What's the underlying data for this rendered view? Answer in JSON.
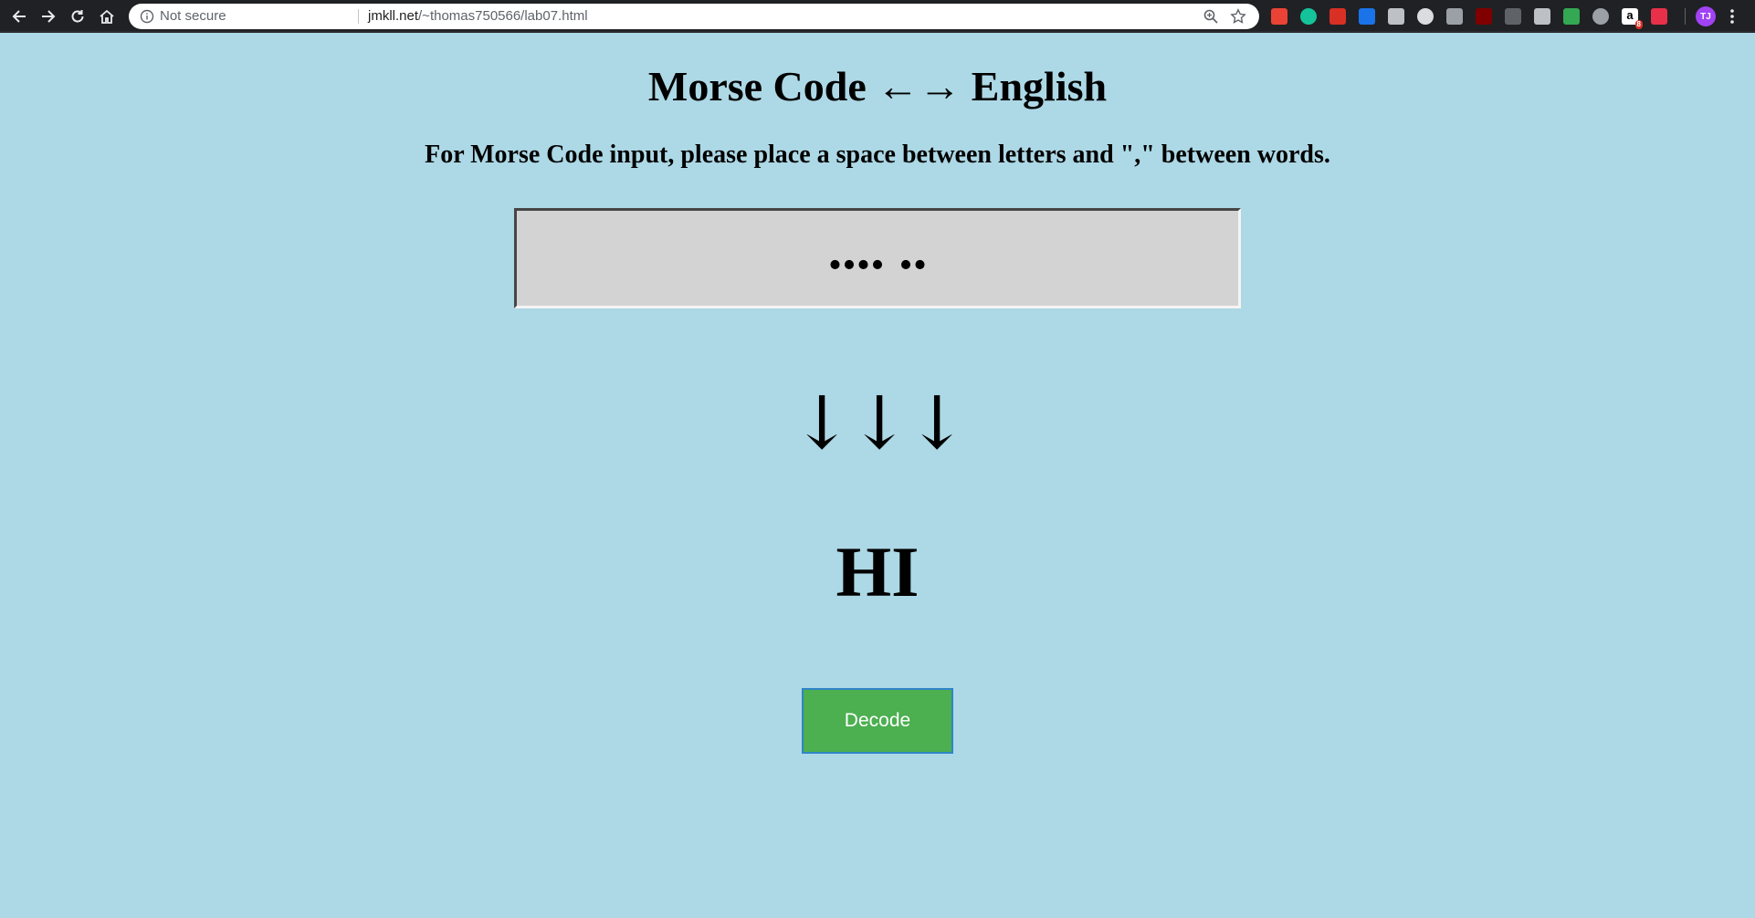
{
  "browser": {
    "security_label": "Not secure",
    "url_host": "jmkll.net",
    "url_path": "/~thomas750566/lab07.html",
    "profile_initials": "TJ",
    "extension_badge": "8",
    "extensions": [
      {
        "icon": "gmail-extension-icon",
        "color": "#ea4335"
      },
      {
        "icon": "grammarly-extension-icon",
        "color": "#15c39a"
      },
      {
        "icon": "bookmark-extension-icon",
        "color": "#d93025"
      },
      {
        "icon": "shield-extension-icon",
        "color": "#1a73e8"
      },
      {
        "icon": "search-extension-icon",
        "color": "#bdc1c6"
      },
      {
        "icon": "cloud-extension-icon",
        "color": "#dadce0"
      },
      {
        "icon": "gamepad-extension-icon",
        "color": "#9aa0a6"
      },
      {
        "icon": "ublock-extension-icon",
        "color": "#800000"
      },
      {
        "icon": "screenshot-extension-icon",
        "color": "#5f6368"
      },
      {
        "icon": "paint-extension-icon",
        "color": "#bdc1c6"
      },
      {
        "icon": "grid-extension-icon",
        "color": "#34a853"
      },
      {
        "icon": "settings-extension-icon",
        "color": "#9aa0a6"
      },
      {
        "icon": "amazon-extension-icon",
        "color": "#000000"
      },
      {
        "icon": "folder-extension-icon",
        "color": "#e8304a"
      }
    ]
  },
  "page": {
    "title": "Morse Code ←→ English",
    "instructions": "For Morse Code input, please place a space between letters and \",\" between words.",
    "input_value": ".... ..",
    "arrows": "↓↓↓",
    "result": "HI",
    "decode_label": "Decode",
    "background": "#add8e6",
    "button_color": "#4caf50"
  }
}
